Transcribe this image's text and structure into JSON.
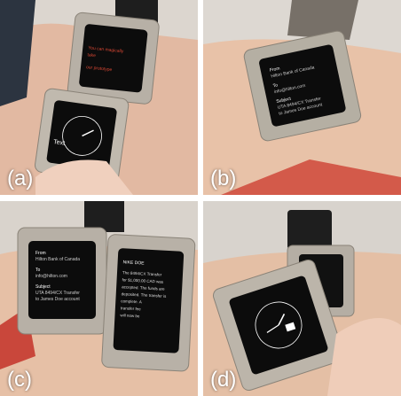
{
  "panels": [
    {
      "caption": "(a)",
      "screen_lines": [
        "You can magically",
        "take",
        "our prototype"
      ],
      "watch_label": "Text"
    },
    {
      "caption": "(b)",
      "screen_lines": [
        "From",
        "Hilton Bank of Canada",
        "To",
        "info@hilton.com",
        "Subject",
        "UTA 8494/CX Transfer",
        "to James Doe account"
      ]
    },
    {
      "caption": "(c)",
      "screen_lines": [
        "From",
        "Hilton Bank of Canada",
        "To",
        "info@hilton.com",
        "Subject",
        "UTA 8494/CX Transfer",
        "to James Doe account"
      ],
      "second_screen_lines": [
        "NIKE DOE",
        "The 8494/CX Transfer",
        "for $1,000.00 CAD was",
        "accepted. The funds are",
        "deposited. The transfer is",
        "complete. A",
        "transfer fee",
        "will now be"
      ]
    },
    {
      "caption": "(d)"
    }
  ],
  "colors": {
    "skin": "#e8c1a8",
    "bracelet": "#b8b2a7",
    "strap": "#1c1c1c",
    "screen": "#0c0c0c",
    "accent_red": "#d64633"
  }
}
